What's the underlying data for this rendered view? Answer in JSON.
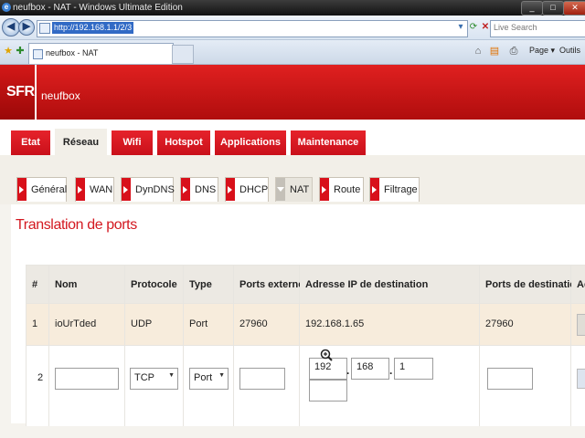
{
  "window": {
    "title": "neufbox - NAT - Windows Ultimate Edition",
    "controls": {
      "minimize": "_",
      "maximize": "□",
      "close": "✕"
    }
  },
  "browser": {
    "url": "http://192.168.1.1/2/3",
    "search_placeholder": "Live Search",
    "tab_title": "neufbox - NAT",
    "commands": {
      "page": "Page ▾",
      "tools": "Outils"
    }
  },
  "header": {
    "logo": "SFR",
    "brand": "neufbox"
  },
  "main_tabs": [
    "Etat",
    "Réseau",
    "Wifi",
    "Hotspot",
    "Applications",
    "Maintenance"
  ],
  "main_tab_active": "Réseau",
  "sub_tabs": [
    "Général",
    "WAN",
    "DynDNS",
    "DNS",
    "DHCP",
    "NAT",
    "Route",
    "Filtrage"
  ],
  "sub_tab_active": "NAT",
  "section_title": "Translation de ports",
  "table": {
    "headers": [
      "#",
      "Nom",
      "Protocole",
      "Type",
      "Ports externes",
      "Adresse IP de destination",
      "Ports de destination",
      "Ac"
    ],
    "row1": {
      "num": "1",
      "name": "ioUrTded",
      "protocol": "UDP",
      "type": "Port",
      "ext_ports": "27960",
      "dest_ip": "192.168.1.65",
      "dest_ports": "27960"
    },
    "row2": {
      "num": "2",
      "protocol": "TCP",
      "type": "Port",
      "ip": [
        "192",
        "168",
        "1"
      ],
      "ip_last_placeholder": "",
      "dot": "."
    }
  }
}
